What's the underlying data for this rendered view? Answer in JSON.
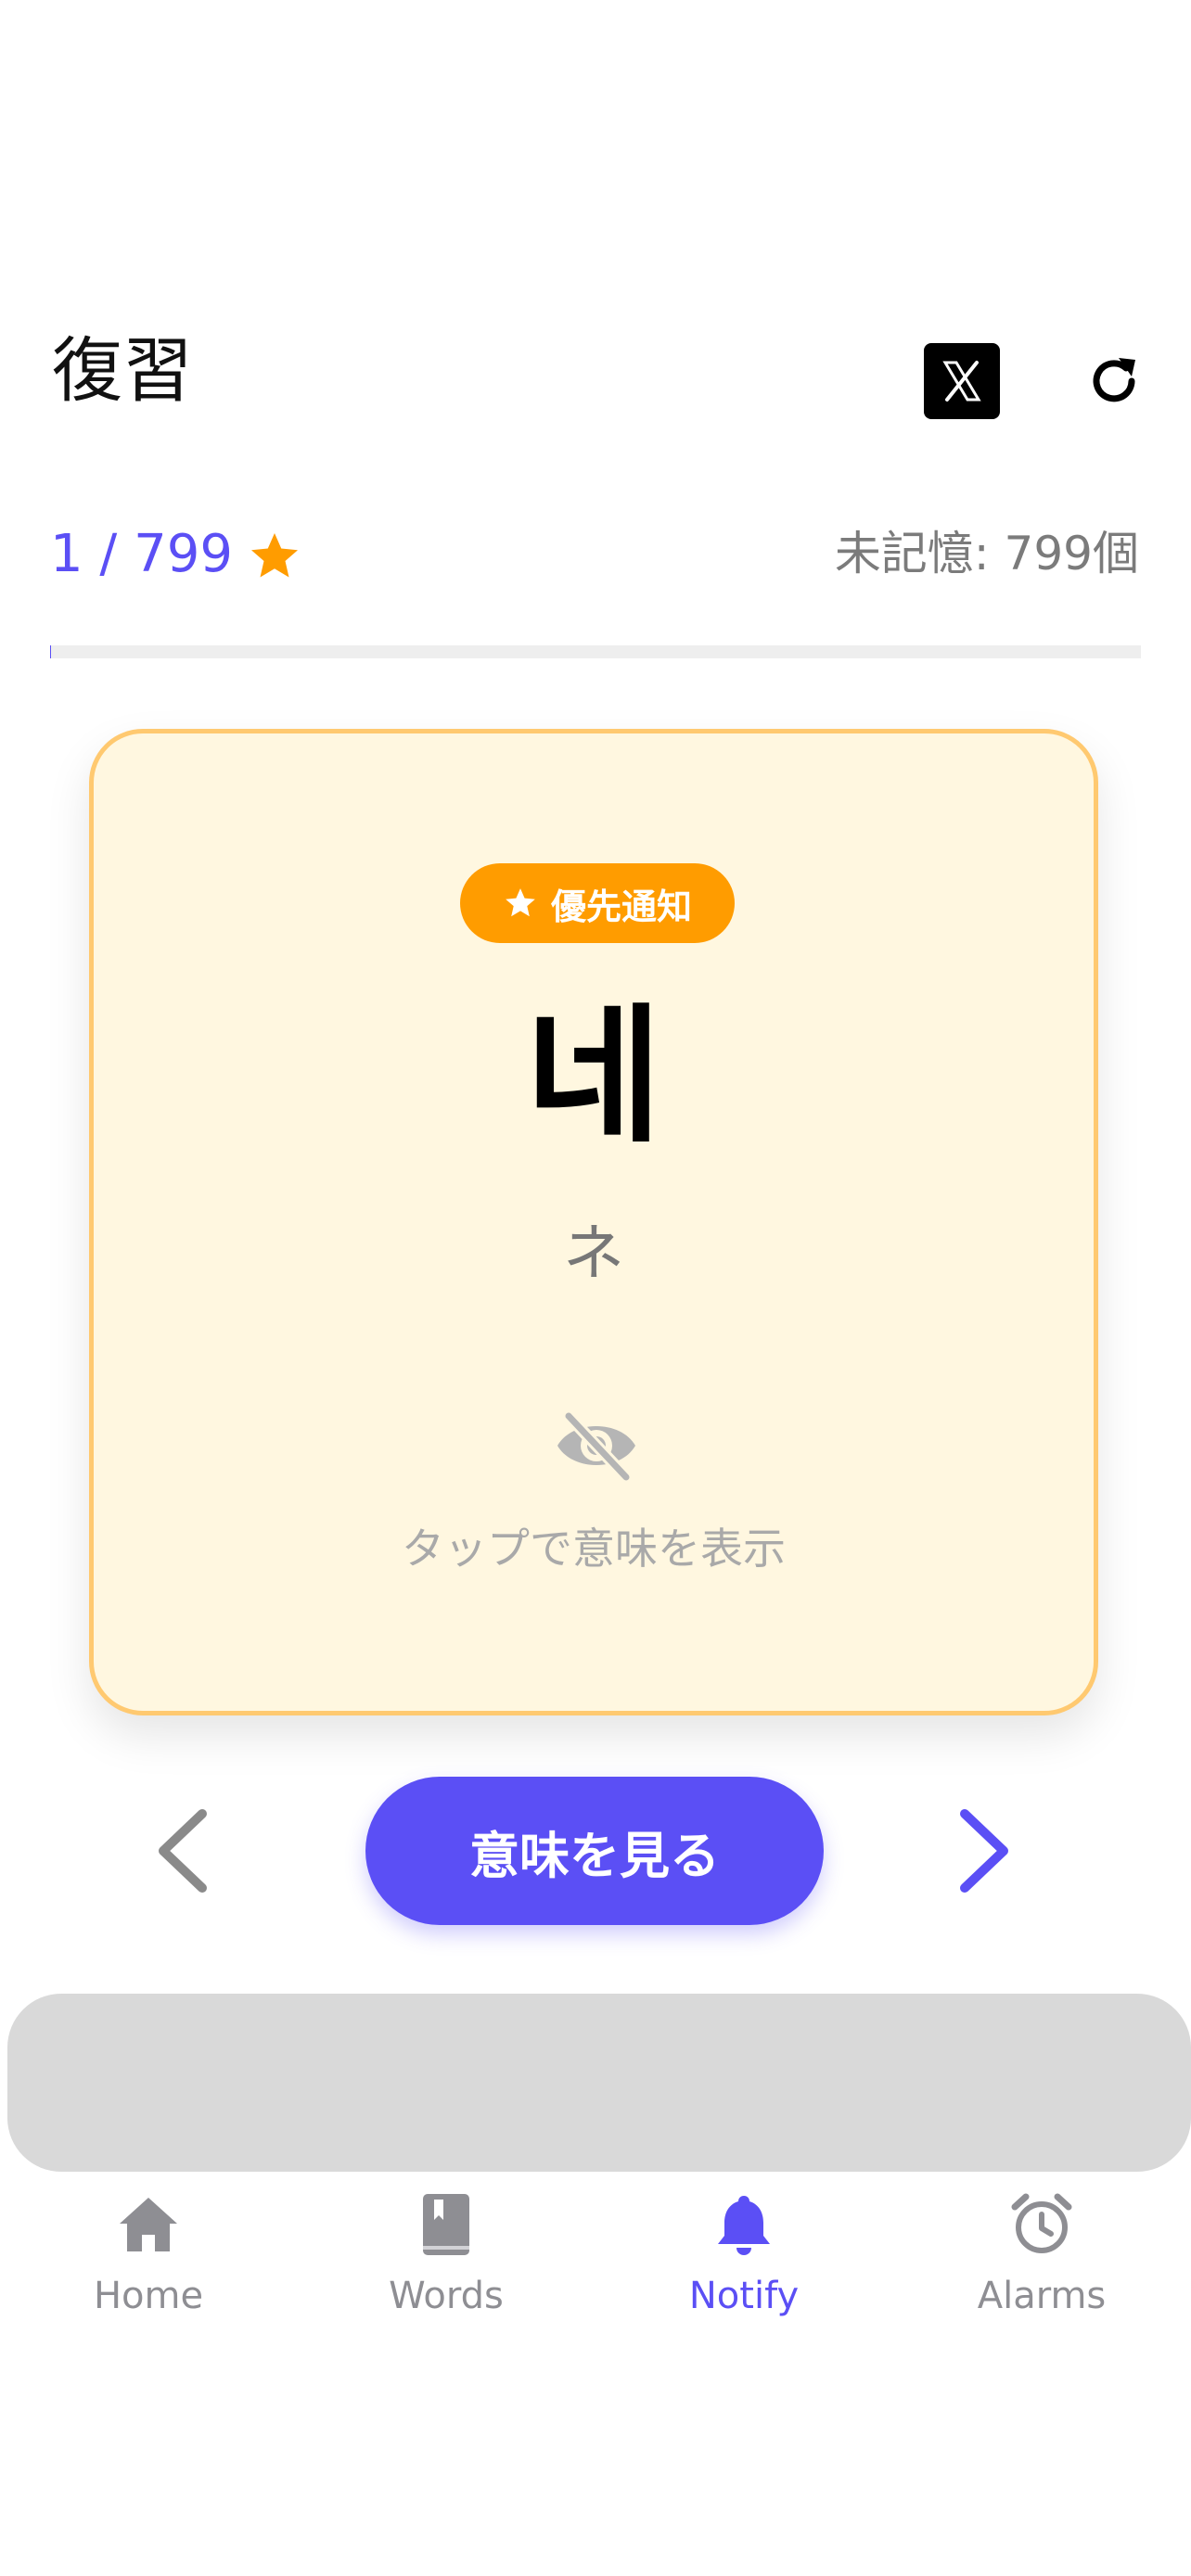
{
  "header": {
    "title": "復習",
    "x_icon": "x-logo-icon",
    "refresh_icon": "refresh-icon"
  },
  "progress": {
    "count_label": "1 / 799",
    "current": 1,
    "total": 799,
    "unlearned_label": "未記憶: 799個",
    "star_icon": "star-icon"
  },
  "card": {
    "badge_label": "優先通知",
    "word": "네",
    "reading": "ネ",
    "hint": "タップで意味を表示",
    "hide_icon": "eye-slash-icon"
  },
  "controls": {
    "show_meaning_label": "意味を見る",
    "prev_icon": "chevron-left-icon",
    "next_icon": "chevron-right-icon"
  },
  "tabs": [
    {
      "label": "Home",
      "icon": "house-icon",
      "active": false
    },
    {
      "label": "Words",
      "icon": "book-icon",
      "active": false
    },
    {
      "label": "Notify",
      "icon": "bell-icon",
      "active": true
    },
    {
      "label": "Alarms",
      "icon": "alarm-clock-icon",
      "active": false
    }
  ],
  "colors": {
    "accent": "#5b4ff5",
    "badge": "#ff9c00",
    "card_background": "#fff7e0",
    "card_border": "#ffc970",
    "ad_placeholder": "#d9d9d9",
    "tab_inactive": "#8e8e93"
  }
}
